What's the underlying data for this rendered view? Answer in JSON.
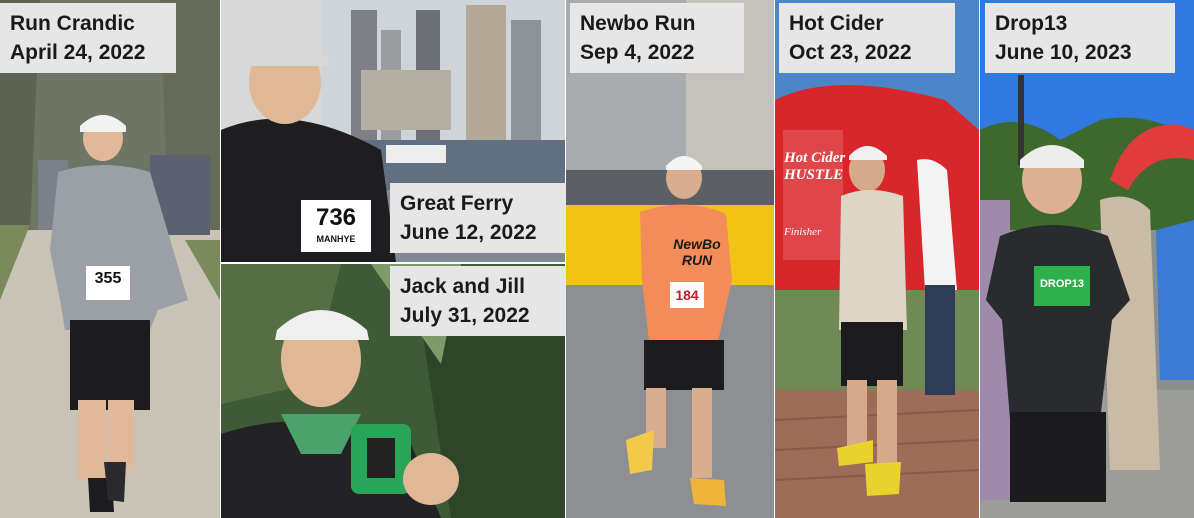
{
  "photos": [
    {
      "id": "run-crandic",
      "title": "Run Crandic",
      "date": "April 24, 2022",
      "bib": "355"
    },
    {
      "id": "great-ferry",
      "title": "Great Ferry",
      "date": "June 12, 2022",
      "bib": "736",
      "bib_name": "MANHYE"
    },
    {
      "id": "jack-and-jill",
      "title": "Jack and Jill",
      "date": "July 31, 2022"
    },
    {
      "id": "newbo-run",
      "title": "Newbo Run",
      "date": "Sep 4, 2022",
      "bib": "184",
      "shirt_text": "NewBo RUN"
    },
    {
      "id": "hot-cider",
      "title": "Hot Cider",
      "date": "Oct 23, 2022",
      "banner_text": "Hot Cider HUSTLE",
      "banner_sub": "Finisher"
    },
    {
      "id": "drop13",
      "title": "Drop13",
      "date": "June 10, 2023",
      "medal_text": "DROP13"
    }
  ],
  "colors": {
    "caption_bg": "#e6e6e6",
    "caption_text": "#1a1a1a",
    "shirt_orange": "#f48c5a",
    "cider_red": "#d9262b",
    "medal_green": "#2bb24c"
  }
}
